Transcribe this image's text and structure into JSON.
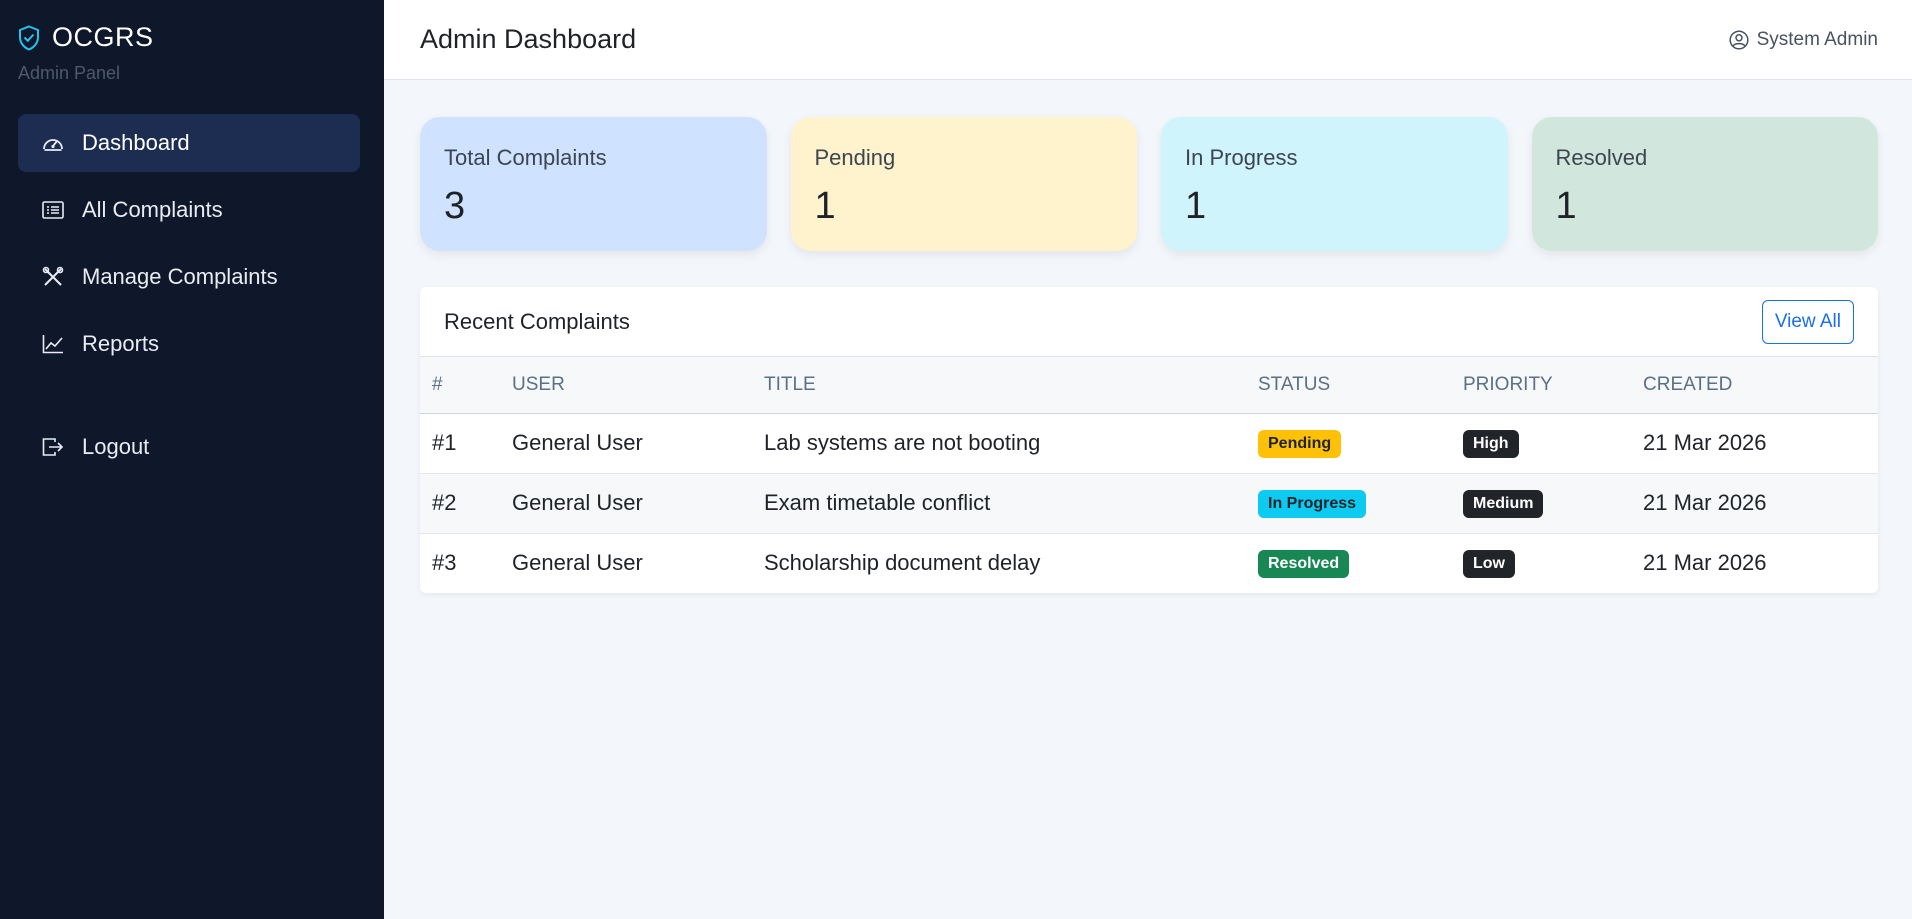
{
  "sidebar": {
    "brand": "OCGRS",
    "subtitle": "Admin Panel",
    "items": [
      {
        "label": "Dashboard",
        "icon": "speedometer-icon"
      },
      {
        "label": "All Complaints",
        "icon": "list-icon"
      },
      {
        "label": "Manage Complaints",
        "icon": "tools-icon"
      },
      {
        "label": "Reports",
        "icon": "chart-icon"
      },
      {
        "label": "Logout",
        "icon": "logout-icon"
      }
    ]
  },
  "header": {
    "title": "Admin Dashboard",
    "user": "System Admin"
  },
  "stats": [
    {
      "label": "Total Complaints",
      "value": "3",
      "color": "#cfe2ff"
    },
    {
      "label": "Pending",
      "value": "1",
      "color": "#fff3cd"
    },
    {
      "label": "In Progress",
      "value": "1",
      "color": "#cff4fc"
    },
    {
      "label": "Resolved",
      "value": "1",
      "color": "#d1e7dd"
    }
  ],
  "recent": {
    "title": "Recent Complaints",
    "view_all": "View All",
    "columns": [
      "#",
      "USER",
      "TITLE",
      "STATUS",
      "PRIORITY",
      "CREATED"
    ],
    "rows": [
      {
        "id": "#1",
        "user": "General User",
        "title": "Lab systems are not booting",
        "status": "Pending",
        "priority": "High",
        "created": "21 Mar 2026"
      },
      {
        "id": "#2",
        "user": "General User",
        "title": "Exam timetable conflict",
        "status": "In Progress",
        "priority": "Medium",
        "created": "21 Mar 2026"
      },
      {
        "id": "#3",
        "user": "General User",
        "title": "Scholarship document delay",
        "status": "Resolved",
        "priority": "Low",
        "created": "21 Mar 2026"
      }
    ]
  },
  "colors": {
    "sidebar_bg": "#0f172b",
    "active_bg": "#1c2d51",
    "accent": "#1a6ef0",
    "brand_icon": "#22c5f0"
  }
}
